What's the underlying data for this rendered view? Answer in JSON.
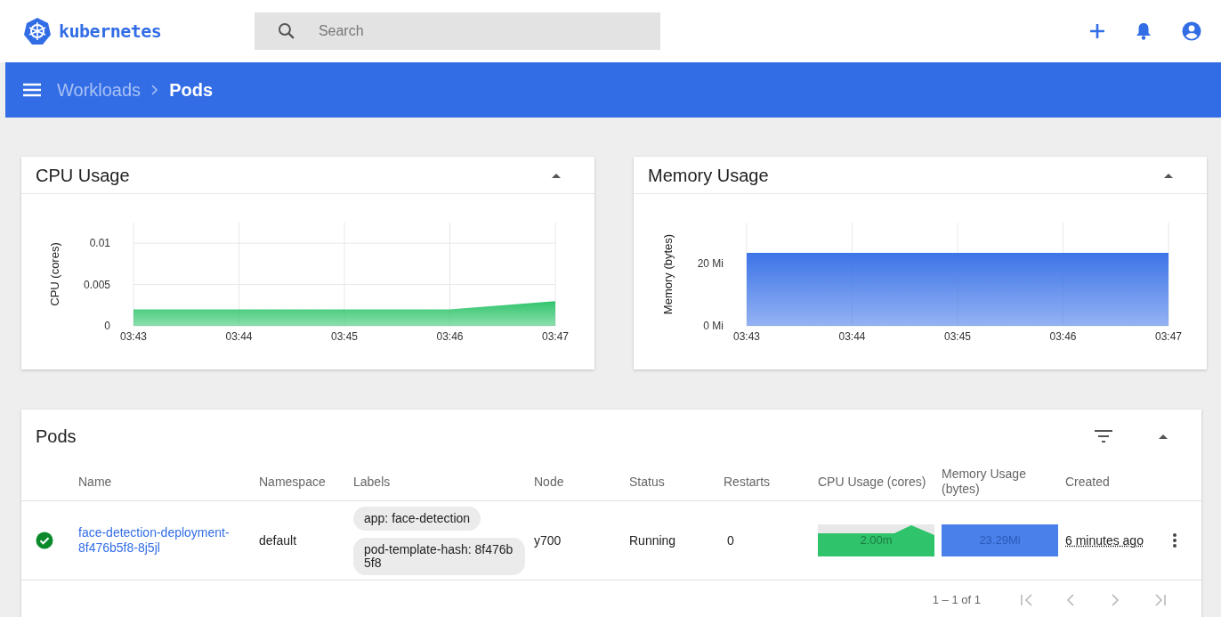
{
  "topbar": {
    "logo_text": "kubernetes",
    "search": {
      "placeholder": "Search"
    }
  },
  "breadcrumb": [
    {
      "label": "Workloads",
      "current": false
    },
    {
      "label": "Pods",
      "current": true
    }
  ],
  "cpu_card": {
    "title": "CPU Usage",
    "chart_data": {
      "type": "area",
      "ylabel": "CPU (cores)",
      "categories": [
        "03:43",
        "03:44",
        "03:45",
        "03:46",
        "03:47"
      ],
      "grid": true,
      "series": [
        {
          "color": "#2fc46b",
          "values": [
            0.002,
            0.002,
            0.002,
            0.002,
            0.003
          ]
        }
      ],
      "ylim": [
        0,
        0.0125
      ],
      "yticks": [
        0,
        0.005,
        0.01
      ]
    }
  },
  "memory_card": {
    "title": "Memory Usage",
    "chart_data": {
      "type": "area",
      "ylabel": "Memory (bytes)",
      "categories": [
        "03:43",
        "03:44",
        "03:45",
        "03:46",
        "03:47"
      ],
      "grid": true,
      "series": [
        {
          "color": "#3d74e8",
          "values": [
            23.3,
            23.3,
            23.3,
            23.3,
            23.3
          ]
        }
      ],
      "ylim": [
        0,
        33
      ],
      "yticks": [
        {
          "value": 0,
          "label": "0 Mi"
        },
        {
          "value": 20,
          "label": "20 Mi"
        }
      ]
    }
  },
  "pods": {
    "title": "Pods",
    "columns": [
      "Name",
      "Namespace",
      "Labels",
      "Node",
      "Status",
      "Restarts",
      "CPU Usage (cores)",
      "Memory Usage (bytes)",
      "Created"
    ],
    "rows": [
      {
        "healthy": true,
        "name": "face-detection-deployment-8f476b5f8-8j5jl",
        "namespace": "default",
        "labels": [
          "app: face-detection",
          "pod-template-hash: 8f476b5f8"
        ],
        "node": "y700",
        "status": "Running",
        "restarts": "0",
        "cpu": "2.00m",
        "memory": "23.29Mi",
        "created": "6 minutes ago"
      }
    ],
    "pagination": {
      "range": "1 – 1 of 1",
      "buttons": [
        {
          "kind": "first",
          "disabled": true
        },
        {
          "kind": "previous",
          "disabled": true
        },
        {
          "kind": "next",
          "disabled": true
        },
        {
          "kind": "last",
          "disabled": true
        }
      ]
    }
  }
}
